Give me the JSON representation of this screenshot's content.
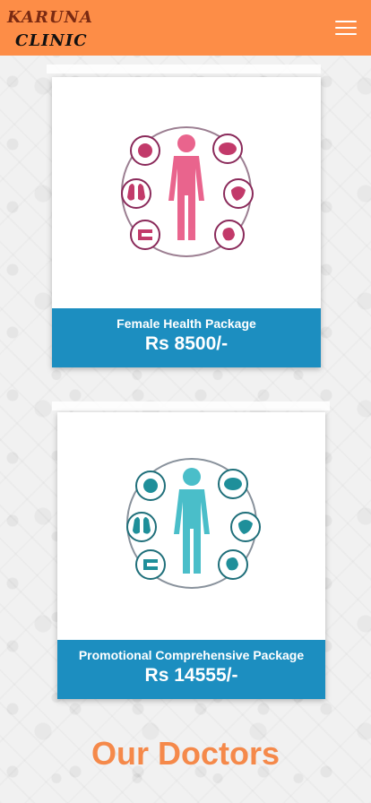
{
  "header": {
    "brand_line1": "KARUNA",
    "brand_line2": "CLINIC",
    "menu_icon": "hamburger-menu-icon",
    "color": "#fd8d47"
  },
  "packages": [
    {
      "name": "Female Health Package",
      "price": "Rs 8500/-",
      "body_color": "#e64a7a",
      "icon": "human-body-organs-icon"
    },
    {
      "name": "Promotional Comprehensive Package",
      "price": "Rs 14555/-",
      "body_color": "#2bb3c0",
      "icon": "human-body-organs-icon"
    }
  ],
  "sections": {
    "doctors_title": "Our Doctors"
  },
  "colors": {
    "footer_blue": "#1c8ec0",
    "accent_orange": "#f5894a"
  }
}
